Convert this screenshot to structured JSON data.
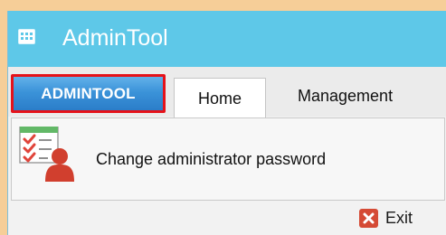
{
  "window": {
    "title": "AdminTool",
    "icon": "app-window-icon"
  },
  "ribbon": {
    "tabs": [
      {
        "label": "ADMINTOOL",
        "highlighted": true
      },
      {
        "label": "Home",
        "selected": true
      },
      {
        "label": "Management"
      }
    ],
    "commands": [
      {
        "label": "Change administrator password",
        "icon": "checklist-user-icon"
      }
    ]
  },
  "footer": {
    "exit_label": "Exit",
    "exit_icon": "close-icon"
  },
  "colors": {
    "page_background": "#f6ce98",
    "titlebar": "#5ec8e8",
    "highlight_frame": "#e5121a",
    "app_tab": "#3b93d9",
    "exit_icon": "#d54a35"
  }
}
